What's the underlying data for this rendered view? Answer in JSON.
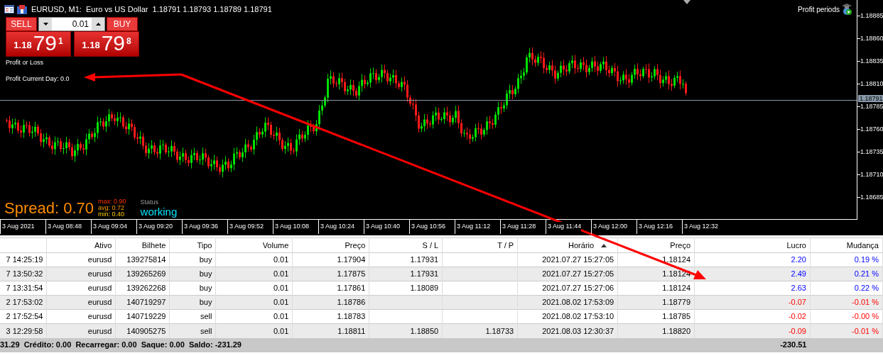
{
  "chart": {
    "title": "EURUSD, M1:  Euro vs US Dollar  1.18791 1.18793 1.18789 1.18791",
    "trade_panel": {
      "sell_label": "SELL",
      "buy_label": "BUY",
      "lot": "0.01",
      "sell_price": {
        "prefix": "1.18",
        "big": "79",
        "small": "1"
      },
      "buy_price": {
        "prefix": "1.18",
        "big": "79",
        "small": "8"
      }
    },
    "profit_or_loss": "Profit or Loss",
    "profit_current_day": "Profit Current Day: 0.0",
    "profit_periods": "Profit periods",
    "spread": "Spread: 0.70",
    "spread_stats": [
      {
        "label": "max:",
        "value": "0.90"
      },
      {
        "label": "avg:",
        "value": "0.72"
      },
      {
        "label": "min:",
        "value": "0.40"
      }
    ],
    "status_label": "Status",
    "status_value": "working",
    "price_axis": [
      "1.18885",
      "1.18860",
      "1.18835",
      "1.18810",
      "1.18785",
      "1.18760",
      "1.18735",
      "1.18710",
      "1.18685"
    ],
    "current_price": "1.18791",
    "time_axis": [
      "3 Aug 2021",
      "3 Aug 08:48",
      "3 Aug 09:04",
      "3 Aug 09:20",
      "3 Aug 09:36",
      "3 Aug 09:52",
      "3 Aug 10:08",
      "3 Aug 10:24",
      "3 Aug 10:40",
      "3 Aug 10:56",
      "3 Aug 11:12",
      "3 Aug 11:28",
      "3 Aug 11:44",
      "3 Aug 12:00",
      "3 Aug 12:16",
      "3 Aug 12:32"
    ]
  },
  "table": {
    "columns": [
      {
        "sorted": false
      },
      {
        "label": "Ativo",
        "sorted": false
      },
      {
        "label": "Bilhete",
        "sorted": false
      },
      {
        "label": "Tipo",
        "sorted": false
      },
      {
        "label": "Volume",
        "sorted": false
      },
      {
        "label": "Preço",
        "sorted": false
      },
      {
        "label": "S / L",
        "sorted": false
      },
      {
        "label": "T / P",
        "sorted": false
      },
      {
        "label": "Horário",
        "sorted": true
      },
      {
        "label": "Preço",
        "sorted": false
      },
      {
        "label": "Lucro",
        "sorted": false
      },
      {
        "label": "Mudança",
        "sorted": false
      }
    ],
    "rows": [
      {
        "cells": [
          "7 14:25:19",
          "eurusd",
          "139275814",
          "buy",
          "0.01",
          "1.17904",
          "1.17931",
          "",
          "2021.07.27 15:27:05",
          "1.18124",
          "2.20",
          "0.19 %"
        ],
        "loss": false
      },
      {
        "cells": [
          "7 13:50:32",
          "eurusd",
          "139265269",
          "buy",
          "0.01",
          "1.17875",
          "1.17931",
          "",
          "2021.07.27 15:27:05",
          "1.18124",
          "2.49",
          "0.21 %"
        ],
        "loss": false
      },
      {
        "cells": [
          "7 13:31:54",
          "eurusd",
          "139262268",
          "buy",
          "0.01",
          "1.17861",
          "1.18089",
          "",
          "2021.07.27 15:27:06",
          "1.18124",
          "2.63",
          "0.22 %"
        ],
        "loss": false
      },
      {
        "cells": [
          "2 17:53:02",
          "eurusd",
          "140719297",
          "buy",
          "0.01",
          "1.18786",
          "",
          "",
          "2021.08.02 17:53:09",
          "1.18779",
          "-0.07",
          "-0.01 %"
        ],
        "loss": true
      },
      {
        "cells": [
          "2 17:52:54",
          "eurusd",
          "140719229",
          "sell",
          "0.01",
          "1.18783",
          "",
          "",
          "2021.08.02 17:53:10",
          "1.18785",
          "-0.02",
          "-0.00 %"
        ],
        "loss": true
      },
      {
        "cells": [
          "3 12:29:58",
          "eurusd",
          "140905275",
          "sell",
          "0.01",
          "1.18811",
          "1.18850",
          "1.18733",
          "2021.08.03 12:30:37",
          "1.18820",
          "-0.09",
          "-0.01 %"
        ],
        "loss": true
      }
    ],
    "summary": "31.29  Crédito: 0.00  Recarregar: 0.00  Saque: 0.00  Saldo: -231.29",
    "total": "-230.51"
  }
}
